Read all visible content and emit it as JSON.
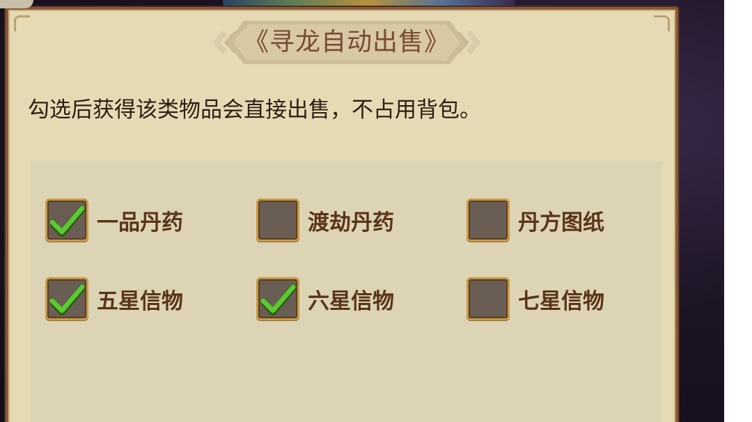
{
  "dialog": {
    "title": "《寻龙自动出售》",
    "description": "勾选后获得该类物品会直接出售，不占用背包。"
  },
  "options": [
    {
      "label": "一品丹药",
      "checked": true
    },
    {
      "label": "渡劫丹药",
      "checked": false
    },
    {
      "label": "丹方图纸",
      "checked": false
    },
    {
      "label": "五星信物",
      "checked": true
    },
    {
      "label": "六星信物",
      "checked": true
    },
    {
      "label": "七星信物",
      "checked": false
    }
  ],
  "colors": {
    "panel_bg": "#e6dab4",
    "options_bg": "#dcd4b4",
    "label_color": "#5a3418",
    "check_green": "#5cc832",
    "checkbox_fill": "#6a5e54",
    "checkbox_border": "#c89a48"
  }
}
